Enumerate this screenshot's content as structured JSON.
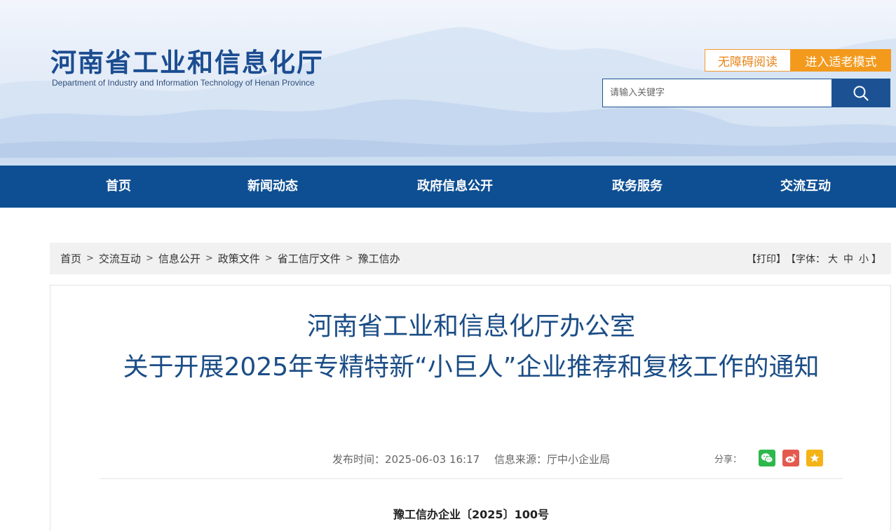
{
  "header": {
    "title": "河南省工业和信息化厅",
    "subtitle": "Department of Industry and Information Technology of Henan Province",
    "accessibility_label": "无障碍阅读",
    "elder_mode_label": "进入适老模式",
    "search_placeholder": "请输入关键字"
  },
  "nav": {
    "items": [
      {
        "label": "首页"
      },
      {
        "label": "新闻动态"
      },
      {
        "label": "政府信息公开"
      },
      {
        "label": "政务服务"
      },
      {
        "label": "交流互动"
      }
    ]
  },
  "breadcrumb": {
    "items": [
      "首页",
      "交流互动",
      "信息公开",
      "政策文件",
      "省工信厅文件",
      "豫工信办"
    ],
    "separator": ">"
  },
  "tools": {
    "print": "【打印】",
    "font_prefix": "【字体：",
    "font_large": "大",
    "font_medium": "中",
    "font_small": "小",
    "font_suffix": "】"
  },
  "article": {
    "title_line1": "河南省工业和信息化厅办公室",
    "title_line2": "关于开展2025年专精特新“小巨人”企业推荐和复核工作的通知",
    "publish_time": "发布时间：2025-06-03 16:17",
    "source": "信息来源：厅中小企业局",
    "share_label": "分享：",
    "doc_number": "豫工信办企业〔2025〕100号"
  },
  "colors": {
    "brand_blue": "#0e4f93",
    "title_blue": "#1b4d86",
    "accent_orange": "#f39a1d"
  }
}
